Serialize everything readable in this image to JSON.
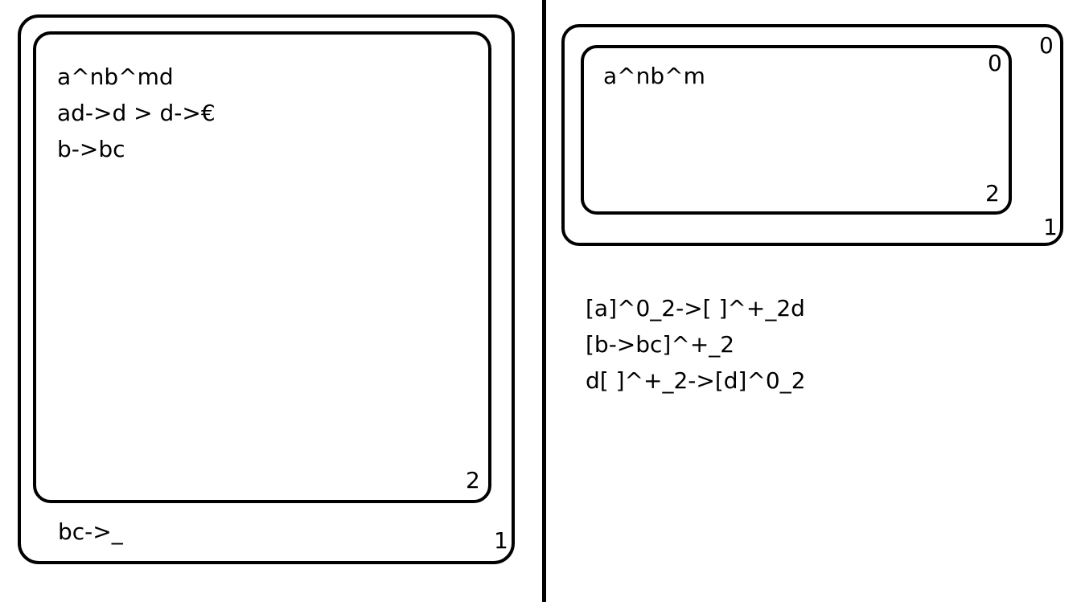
{
  "left_panel": {
    "outer_region": {
      "label": "1",
      "rules": [
        "bc->_"
      ]
    },
    "inner_region": {
      "label": "2",
      "rules": [
        "a^nb^md",
        "ad->d > d->€",
        "b->bc"
      ]
    }
  },
  "right_panel": {
    "outer_region": {
      "labels": [
        "0",
        "1"
      ]
    },
    "inner_region": {
      "labels": [
        "0",
        "2"
      ],
      "content": "a^nb^m"
    },
    "rules": [
      "[a]^0_2->[ ]^+_2d",
      "[b->bc]^+_2",
      "d[ ]^+_2->[d]^0_2"
    ]
  },
  "colors": {
    "stroke": "#000000",
    "background": "#ffffff"
  }
}
